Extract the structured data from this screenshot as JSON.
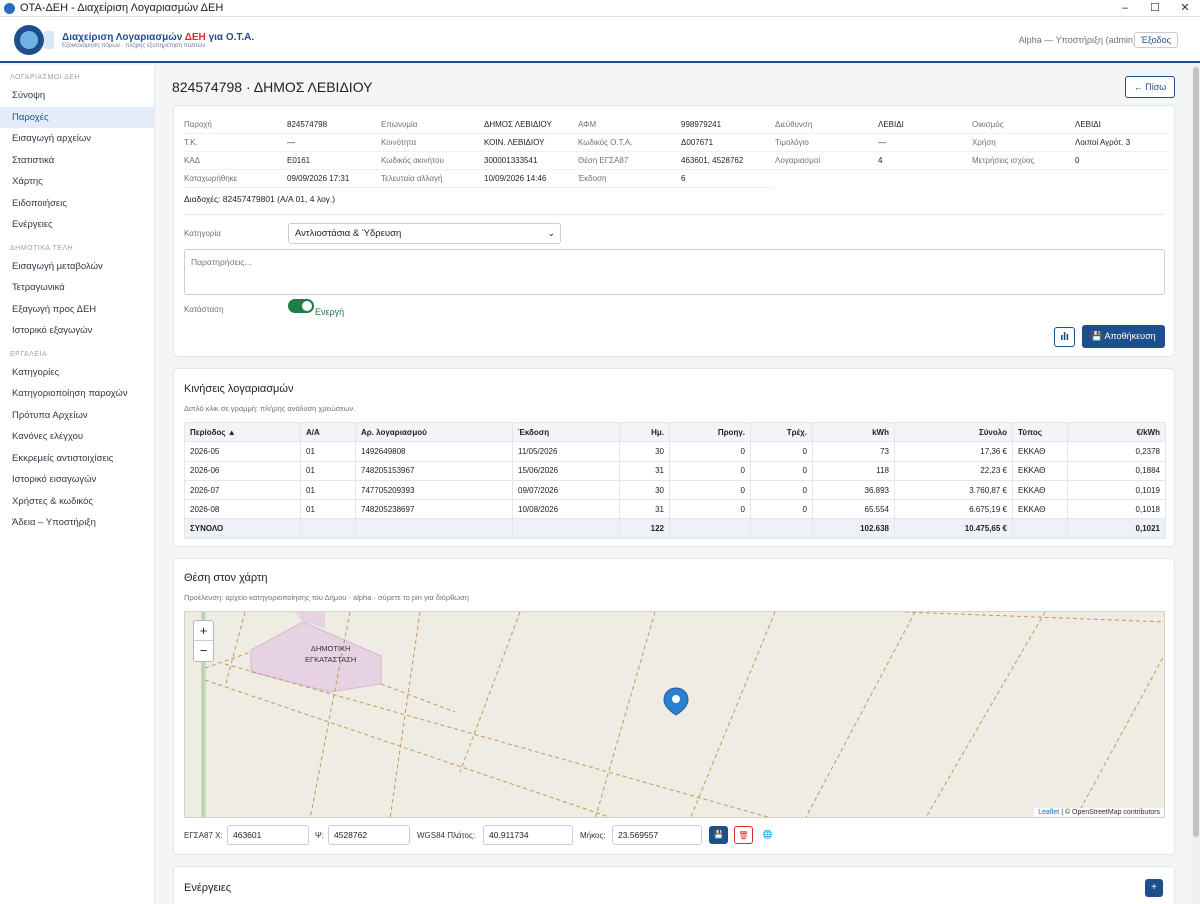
{
  "window": {
    "title": "ΟΤΑ-ΔΕΗ - Διαχείριση Λογαριασμών ΔΕΗ",
    "minimize": "–",
    "maximize": "☐",
    "close": "✕"
  },
  "header": {
    "app_title_prefix": "Διαχείριση Λογαριασμών ",
    "app_title_brand": "ΔΕΗ",
    "app_title_suffix": " για Ο.Τ.Α.",
    "tagline": "Εξοικονόμηση πόρων · πλήρης εξυπηρέτηση πολιτών",
    "user": "Alpha — Υποστήριξη (admin)",
    "logout_label": "Έξοδος"
  },
  "sidebar": {
    "sections": [
      {
        "title": "ΛΟΓΑΡΙΑΣΜΟΙ ΔΕΗ",
        "items": [
          "Σύνοψη",
          "Παροχές",
          "Εισαγωγή αρχείων",
          "Στατιστικά",
          "Χάρτης",
          "Ειδοποιήσεις",
          "Ενέργειες"
        ]
      },
      {
        "title": "ΔΗΜΟΤΙΚΑ ΤΕΛΗ",
        "items": [
          "Εισαγωγή μεταβολών",
          "Τετραγωνικά",
          "Εξαγωγή προς ΔΕΗ",
          "Ιστορικό εξαγωγών"
        ]
      },
      {
        "title": "ΕΡΓΑΛΕΙΑ",
        "items": [
          "Κατηγορίες",
          "Κατηγοριοποίηση παροχών",
          "Πρότυπα Αρχείων",
          "Κανόνες ελέγχου",
          "Εκκρεμείς αντιστοιχίσεις",
          "Ιστορικό εισαγωγών",
          "Χρήστες & κωδικός",
          "Άδεια – Υποστήριξη"
        ]
      }
    ],
    "active": "Παροχές"
  },
  "page": {
    "title": "824574798 · ΔΗΜΟΣ ΛΕΒΙΔΙΟΥ",
    "back_label": "← Πίσω"
  },
  "info": {
    "columns": [
      [
        [
          "Παροχή",
          "824574798"
        ],
        [
          "Τ.Κ.",
          "—"
        ],
        [
          "ΚΑΔ",
          "Ε0161"
        ],
        [
          "Καταχωρήθηκε",
          "09/09/2026 17:31"
        ]
      ],
      [
        [
          "Επωνυμία",
          "ΔΗΜΟΣ ΛΕΒΙΔΙΟΥ"
        ],
        [
          "Κοινότητα",
          "ΚΟΙΝ. ΛΕΒΙΔΙΟΥ"
        ],
        [
          "Κωδικός ακινήτου",
          "300001333541"
        ],
        [
          "Τελευταία αλλαγή",
          "10/09/2026 14:46"
        ]
      ],
      [
        [
          "ΑΦΜ",
          "998979241"
        ],
        [
          "Κωδικός Ο.Τ.Α.",
          "Δ007671"
        ],
        [
          "Θέση ΕΓΣΑ87",
          "463601, 4528762"
        ],
        [
          "Έκδοση",
          "6"
        ]
      ],
      [
        [
          "Διεύθυνση",
          "ΛΕΒΙΔΙ"
        ],
        [
          "Τιμολόγιο",
          "—"
        ],
        [
          "Λογαριασμοί",
          "4"
        ]
      ],
      [
        [
          "Οικισμός",
          "ΛΕΒΙΔΙ"
        ],
        [
          "Χρήση",
          "Λοιποί Αγρότ. 3"
        ],
        [
          "Μετρήσεις ισχύος",
          "0"
        ]
      ]
    ],
    "successors": "Διαδοχές: 82457479801 (Α/Α 01, 4 λογ.)"
  },
  "form": {
    "category_label": "Κατηγορία",
    "category_value": "Αντλιοστάσια & Ύδρευση",
    "notes_placeholder": "Παρατηρήσεις...",
    "status_label": "Κατάσταση",
    "status_value": "Ενεργή",
    "save_label": "Αποθήκευση"
  },
  "transactions": {
    "title": "Κινήσεις λογαριασμών",
    "hint": "Διπλό κλικ σε γραμμή: πλήρης ανάλυση χρεώσεων.",
    "columns": [
      "Περίοδος ▲",
      "Α/Α",
      "Αρ. λογαριασμού",
      "Έκδοση",
      "Ημ.",
      "Προηγ.",
      "Τρέχ.",
      "kWh",
      "Σύνολο",
      "Τύπος",
      "€/kWh"
    ],
    "rows": [
      [
        "2026-05",
        "01",
        "1492649808",
        "11/05/2026",
        "30",
        "0",
        "0",
        "73",
        "17,36 €",
        "ΕΚΚΑΘ",
        "0,2378"
      ],
      [
        "2026-06",
        "01",
        "748205153967",
        "15/06/2026",
        "31",
        "0",
        "0",
        "118",
        "22,23 €",
        "ΕΚΚΑΘ",
        "0,1884"
      ],
      [
        "2026-07",
        "01",
        "747705209393",
        "09/07/2026",
        "30",
        "0",
        "0",
        "36.893",
        "3.760,87 €",
        "ΕΚΚΑΘ",
        "0,1019"
      ],
      [
        "2026-08",
        "01",
        "748205238697",
        "10/08/2026",
        "31",
        "0",
        "0",
        "65.554",
        "6.675,19 €",
        "ΕΚΚΑΘ",
        "0,1018"
      ]
    ],
    "total": [
      "ΣΥΝΟΛΟ",
      "",
      "",
      "",
      "122",
      "",
      "",
      "102.638",
      "10.475,65 €",
      "",
      "0,1021"
    ]
  },
  "map": {
    "title": "Θέση στον χάρτη",
    "source": "Προέλευση: αρχείο κατηγοριοποίησης του Δήμου · alpha · σύρετε το pin για διόρθωση",
    "zoom_in": "+",
    "zoom_out": "−",
    "label_line1": "ΔΗΜΟΤΙΚΗ",
    "label_line2": "ΕΓΚΑΤΑΣΤΑΣΗ",
    "attribution_leaflet": "Leaflet",
    "attribution_rest": " | © OpenStreetMap contributors",
    "x_label": "ΕΓΣΑ87 Χ:",
    "x_value": "463601",
    "y_label": "Ψ:",
    "y_value": "4528762",
    "lat_label": "WGS84 Πλάτος:",
    "lat_value": "40.911734",
    "lon_label": "Μήκος:",
    "lon_value": "23.569557"
  },
  "actions": {
    "title": "Ενέργειες",
    "add": "+"
  },
  "colors": {
    "primary": "#1f4e8c",
    "success": "#1e7e45",
    "danger": "#d32f2f",
    "map_bg": "#efece3"
  }
}
